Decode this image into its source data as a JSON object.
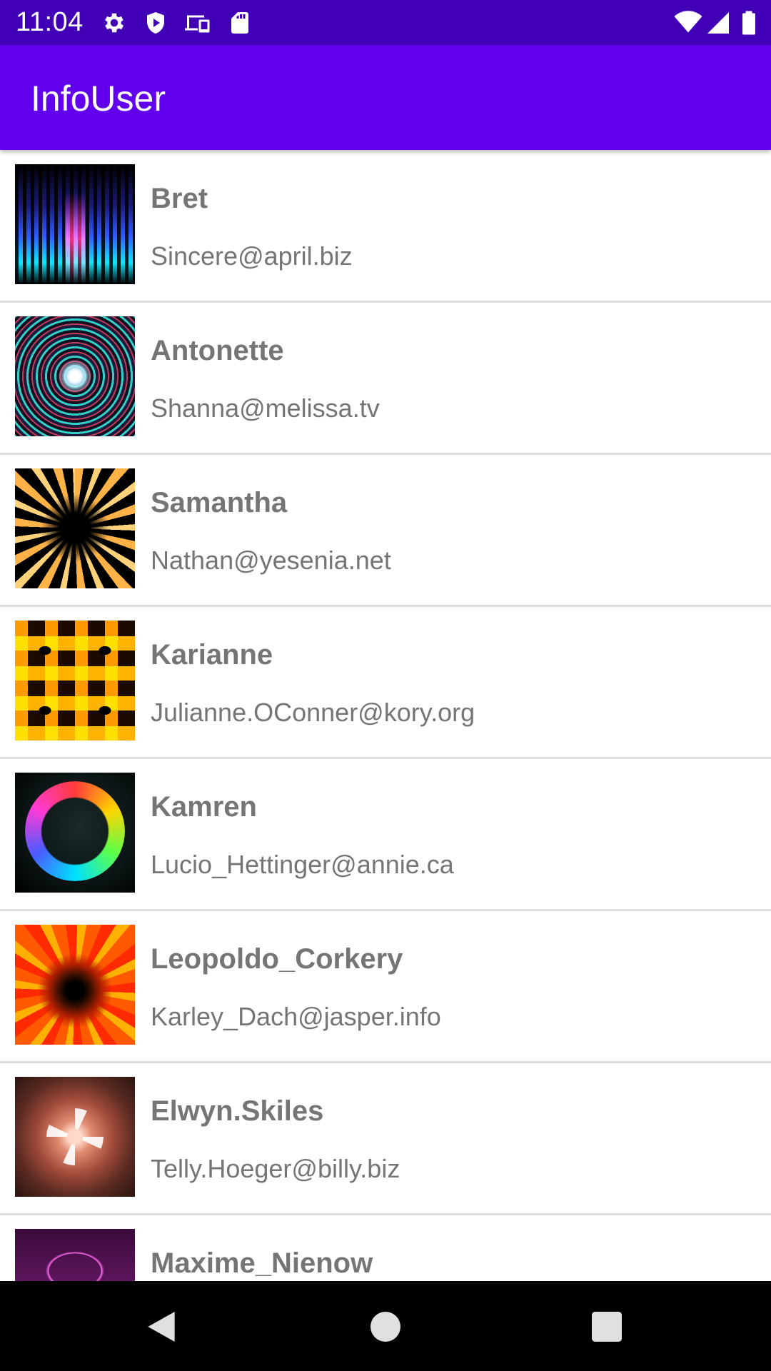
{
  "status_bar": {
    "time": "11:04",
    "icons": [
      "gear-icon",
      "shield-icon",
      "devices-icon",
      "sd-card-icon",
      "wifi-icon",
      "signal-icon",
      "battery-icon"
    ],
    "background": "#4200b6"
  },
  "app_bar": {
    "title": "InfoUser",
    "background": "#6200ee"
  },
  "users": [
    {
      "name": "Bret",
      "email": "Sincere@april.biz"
    },
    {
      "name": "Antonette",
      "email": "Shanna@melissa.tv"
    },
    {
      "name": "Samantha",
      "email": "Nathan@yesenia.net"
    },
    {
      "name": "Karianne",
      "email": "Julianne.OConner@kory.org"
    },
    {
      "name": "Kamren",
      "email": "Lucio_Hettinger@annie.ca"
    },
    {
      "name": "Leopoldo_Corkery",
      "email": "Karley_Dach@jasper.info"
    },
    {
      "name": "Elwyn.Skiles",
      "email": "Telly.Hoeger@billy.biz"
    },
    {
      "name": "Maxime_Nienow",
      "email": ""
    }
  ],
  "nav_bar": {
    "buttons": [
      "back-icon",
      "home-icon",
      "recents-icon"
    ]
  }
}
